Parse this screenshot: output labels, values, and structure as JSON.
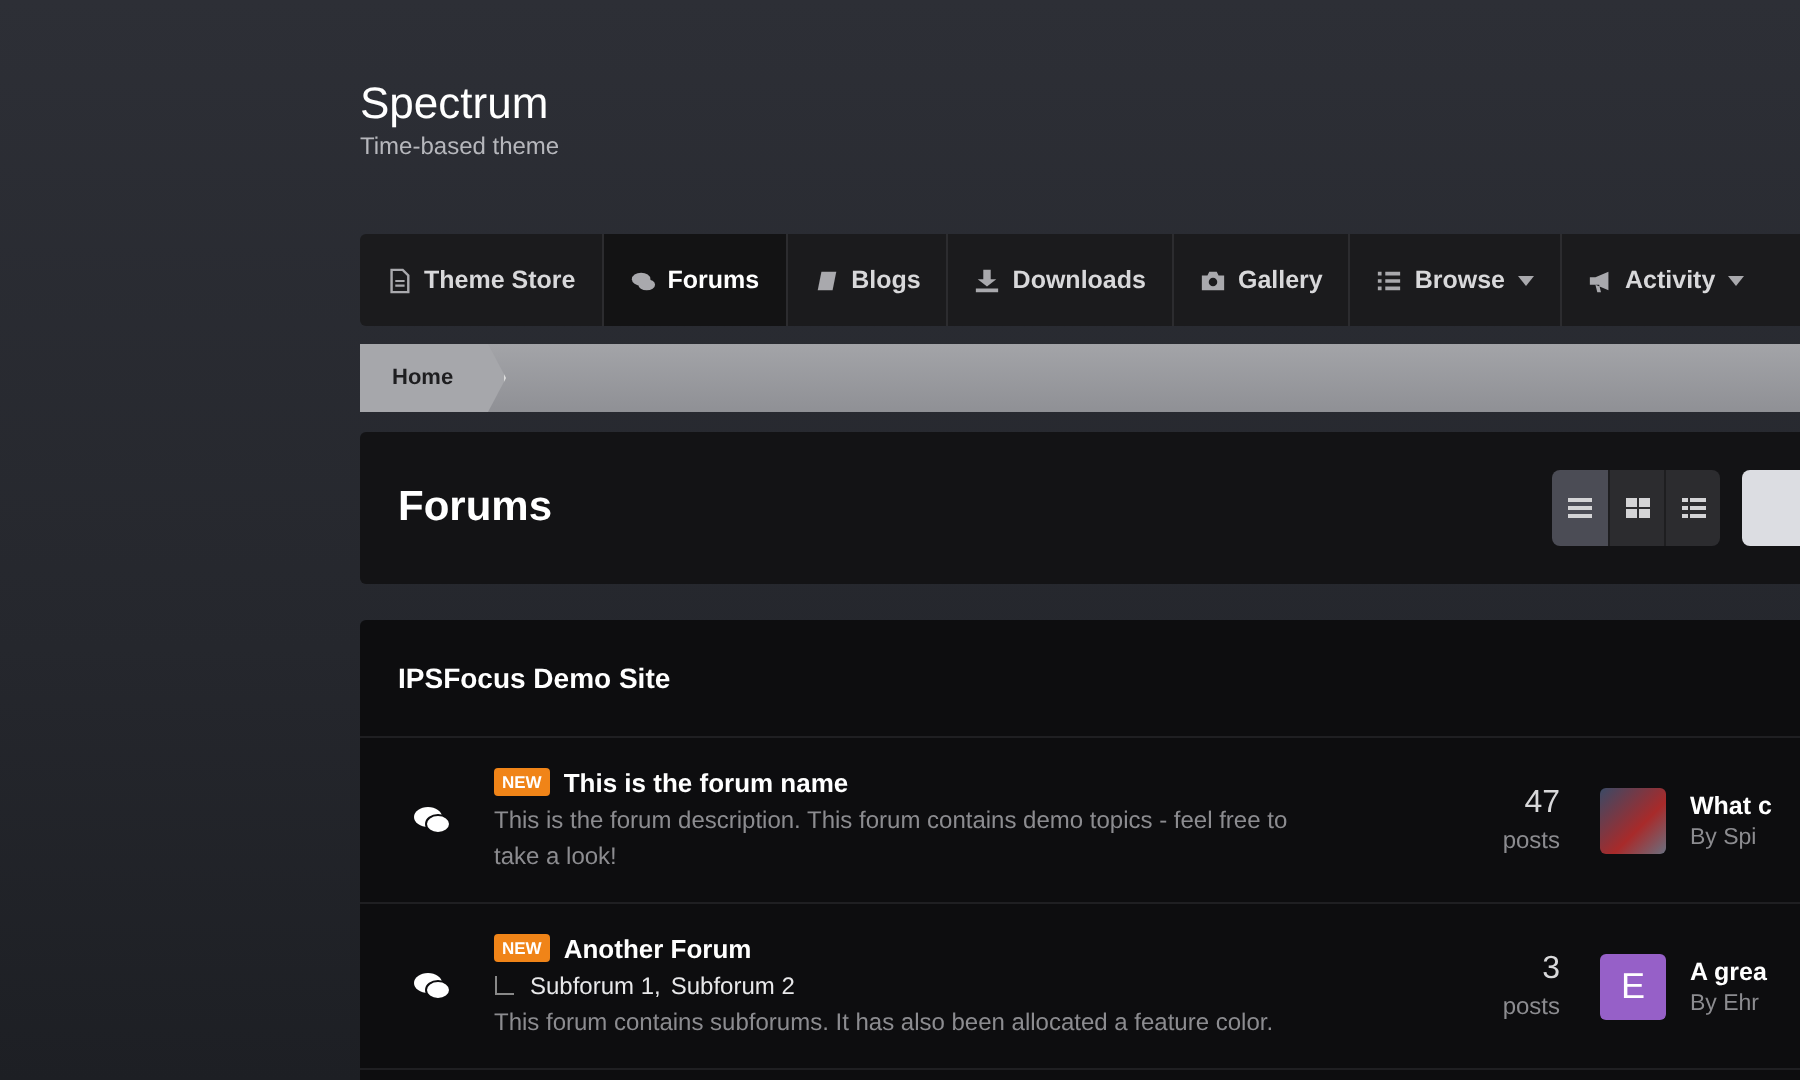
{
  "site": {
    "title": "Spectrum",
    "tagline": "Time-based theme"
  },
  "nav": [
    {
      "label": "Theme Store",
      "kind": "document",
      "selected": false,
      "menu": false
    },
    {
      "label": "Forums",
      "kind": "chat",
      "selected": true,
      "menu": false
    },
    {
      "label": "Blogs",
      "kind": "book",
      "selected": false,
      "menu": false
    },
    {
      "label": "Downloads",
      "kind": "download",
      "selected": false,
      "menu": false
    },
    {
      "label": "Gallery",
      "kind": "camera",
      "selected": false,
      "menu": false
    },
    {
      "label": "Browse",
      "kind": "list",
      "selected": false,
      "menu": true
    },
    {
      "label": "Activity",
      "kind": "megaphone",
      "selected": false,
      "menu": true
    }
  ],
  "breadcrumb": [
    "Home"
  ],
  "page": {
    "title": "Forums",
    "views": [
      {
        "kind": "rows",
        "selected": true
      },
      {
        "kind": "grid",
        "selected": false
      },
      {
        "kind": "list",
        "selected": false
      }
    ]
  },
  "category": {
    "title": "IPSFocus Demo Site",
    "forums": [
      {
        "badge": "NEW",
        "name": "This is the forum name",
        "description": "This is the forum description. This forum contains demo topics - feel free to take a look!",
        "count": "47",
        "count_label": "posts",
        "avatar": {
          "kind": "photo"
        },
        "last_title": "What c",
        "last_by": "By Spi"
      },
      {
        "badge": "NEW",
        "name": "Another Forum",
        "subforums": [
          "Subforum 1,",
          "Subforum 2"
        ],
        "description": "This forum contains subforums. It has also been allocated a feature color.",
        "count": "3",
        "count_label": "posts",
        "avatar": {
          "kind": "letter",
          "letter": "E",
          "color": "#9660c8"
        },
        "last_title": "A grea",
        "last_by": "By Ehr"
      }
    ]
  }
}
